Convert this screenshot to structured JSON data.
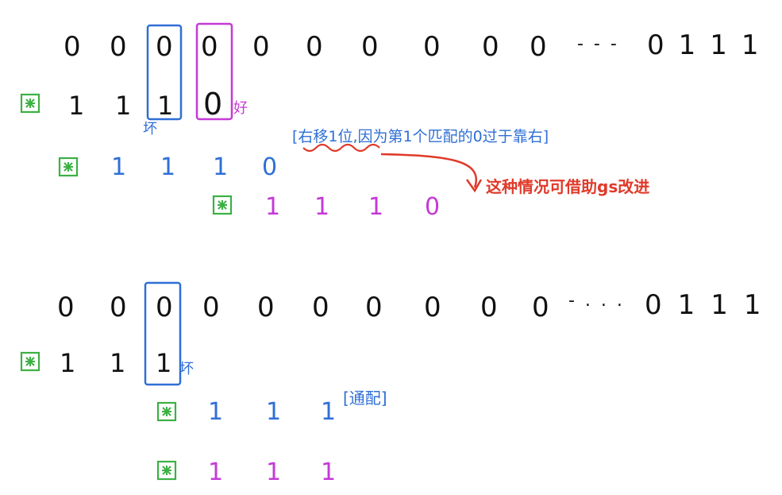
{
  "colors": {
    "black": "#111111",
    "blue": "#2f6fd6",
    "magenta": "#c43ad6",
    "green": "#3cb043",
    "red": "#e03a2a"
  },
  "top": {
    "text_row": [
      "0",
      "0",
      "0",
      "0",
      "0",
      "0",
      "0",
      "0",
      "0",
      "0"
    ],
    "text_tail": "0111",
    "ellipsis": "- - -",
    "pattern_rows": [
      [
        "1",
        "1",
        "1",
        "0"
      ],
      [
        "1",
        "1",
        "1",
        "0"
      ],
      [
        "1",
        "1",
        "1",
        "0"
      ]
    ],
    "bad_label": "坏",
    "good_label": "好",
    "note": "[右移1位,因为第1个匹配的0过于靠右]",
    "red_note": "这种情况可借助gs改进"
  },
  "bottom": {
    "text_row": [
      "0",
      "0",
      "0",
      "0",
      "0",
      "0",
      "0",
      "0",
      "0",
      "0"
    ],
    "text_tail": "0111",
    "ellipsis": "- . . .",
    "pattern_rows": [
      [
        "1",
        "1",
        "1"
      ],
      [
        "1",
        "1",
        "1"
      ],
      [
        "1",
        "1",
        "1"
      ]
    ],
    "bad_label": "坏",
    "note": "[通配]"
  },
  "icons": {
    "pattern_marker": "star-box-icon"
  }
}
